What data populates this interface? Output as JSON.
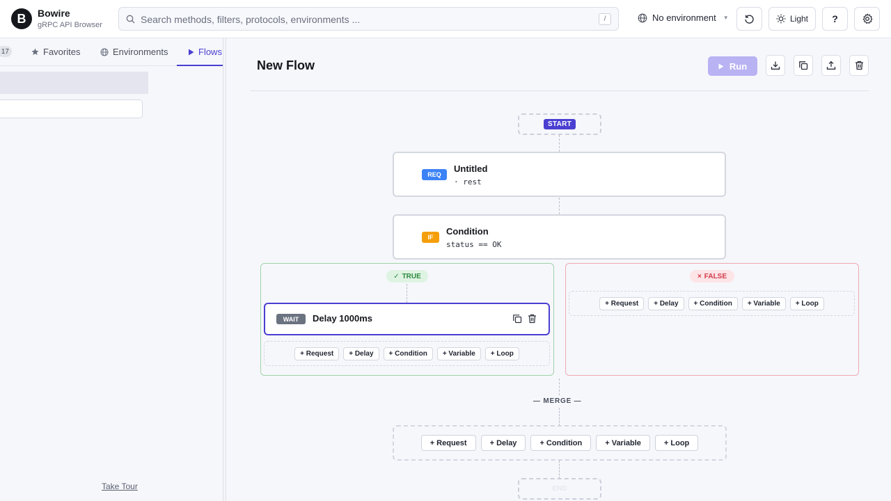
{
  "app": {
    "name": "Bowire",
    "subtitle": "gRPC API Browser",
    "logo_letter": "B"
  },
  "search": {
    "placeholder": "Search methods, filters, protocols, environments ...",
    "shortcut": "/"
  },
  "environment": {
    "label": "No environment"
  },
  "header_buttons": {
    "theme_label": "Light",
    "help_label": "?"
  },
  "sidebar": {
    "count": "17",
    "tabs": [
      {
        "label": "Favorites",
        "icon": "star-icon"
      },
      {
        "label": "Environments",
        "icon": "globe-icon"
      },
      {
        "label": "Flows",
        "icon": "play-icon",
        "active": true
      }
    ],
    "take_tour": "Take Tour"
  },
  "flow": {
    "title": "New Flow",
    "run_label": "Run",
    "start_label": "START",
    "end_label": "END",
    "request_node": {
      "badge": "REQ",
      "title": "Untitled",
      "subtitle": "· rest"
    },
    "condition_node": {
      "badge": "IF",
      "title": "Condition",
      "subtitle": "status == OK"
    },
    "true_branch": {
      "label": "TRUE",
      "wait_node": {
        "badge": "WAIT",
        "title": "Delay 1000ms"
      }
    },
    "false_branch": {
      "label": "FALSE"
    },
    "merge_label": "— MERGE —",
    "add_buttons": [
      "+ Request",
      "+ Delay",
      "+ Condition",
      "+ Variable",
      "+ Loop"
    ]
  },
  "colors": {
    "accent": "#4a3fd1",
    "run_disabled": "#b9b3f3",
    "req_badge": "#3b82f6",
    "if_badge": "#f59e0b",
    "wait_badge": "#6b7280",
    "true_green": "#2c8a3e",
    "false_red": "#d23b4a"
  }
}
